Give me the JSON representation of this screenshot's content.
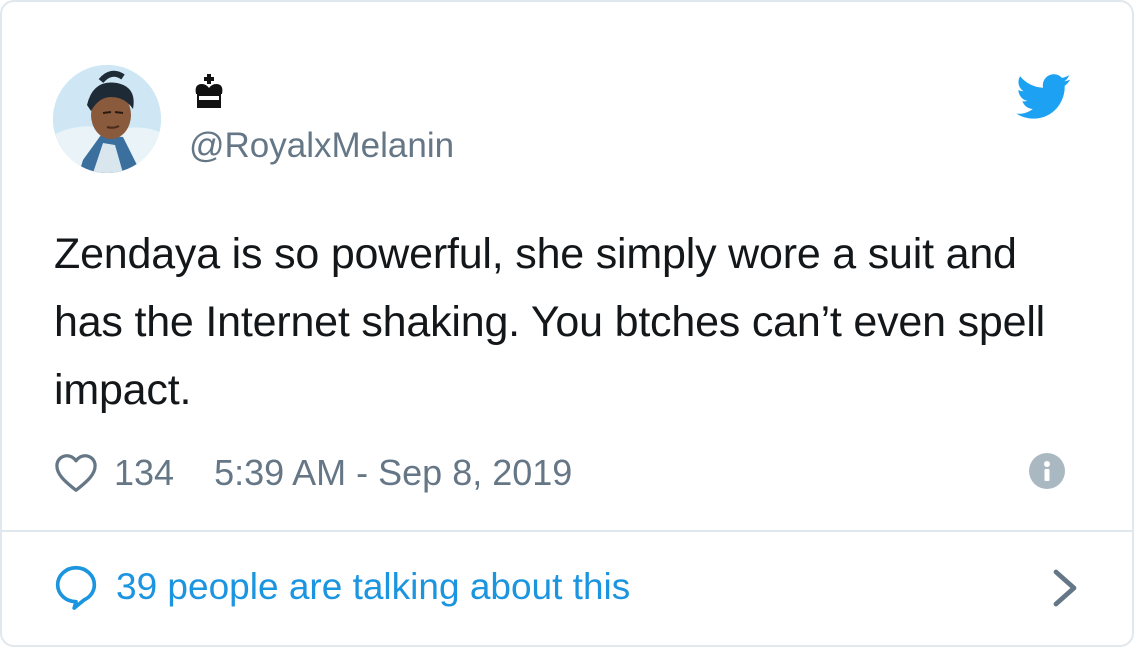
{
  "tweet": {
    "author": {
      "avatar_icon": "avatar-cartoon-portrait",
      "display_name_icon": "crown-emoji",
      "handle": "@RoyalxMelanin"
    },
    "platform_icon": "twitter-bird-icon",
    "text": "Zendaya is so powerful, she simply wore a suit and has the Internet shaking. You btches can’t even spell impact.",
    "likes": "134",
    "timestamp": "5:39 AM - Sep 8, 2019",
    "info_icon": "info-icon",
    "talking_label": "39 people are talking about this"
  },
  "colors": {
    "brand_blue": "#1da1f2",
    "link_blue": "#1b95e0",
    "muted_gray": "#657786",
    "border": "#e1e8ed",
    "text": "#14171a"
  }
}
